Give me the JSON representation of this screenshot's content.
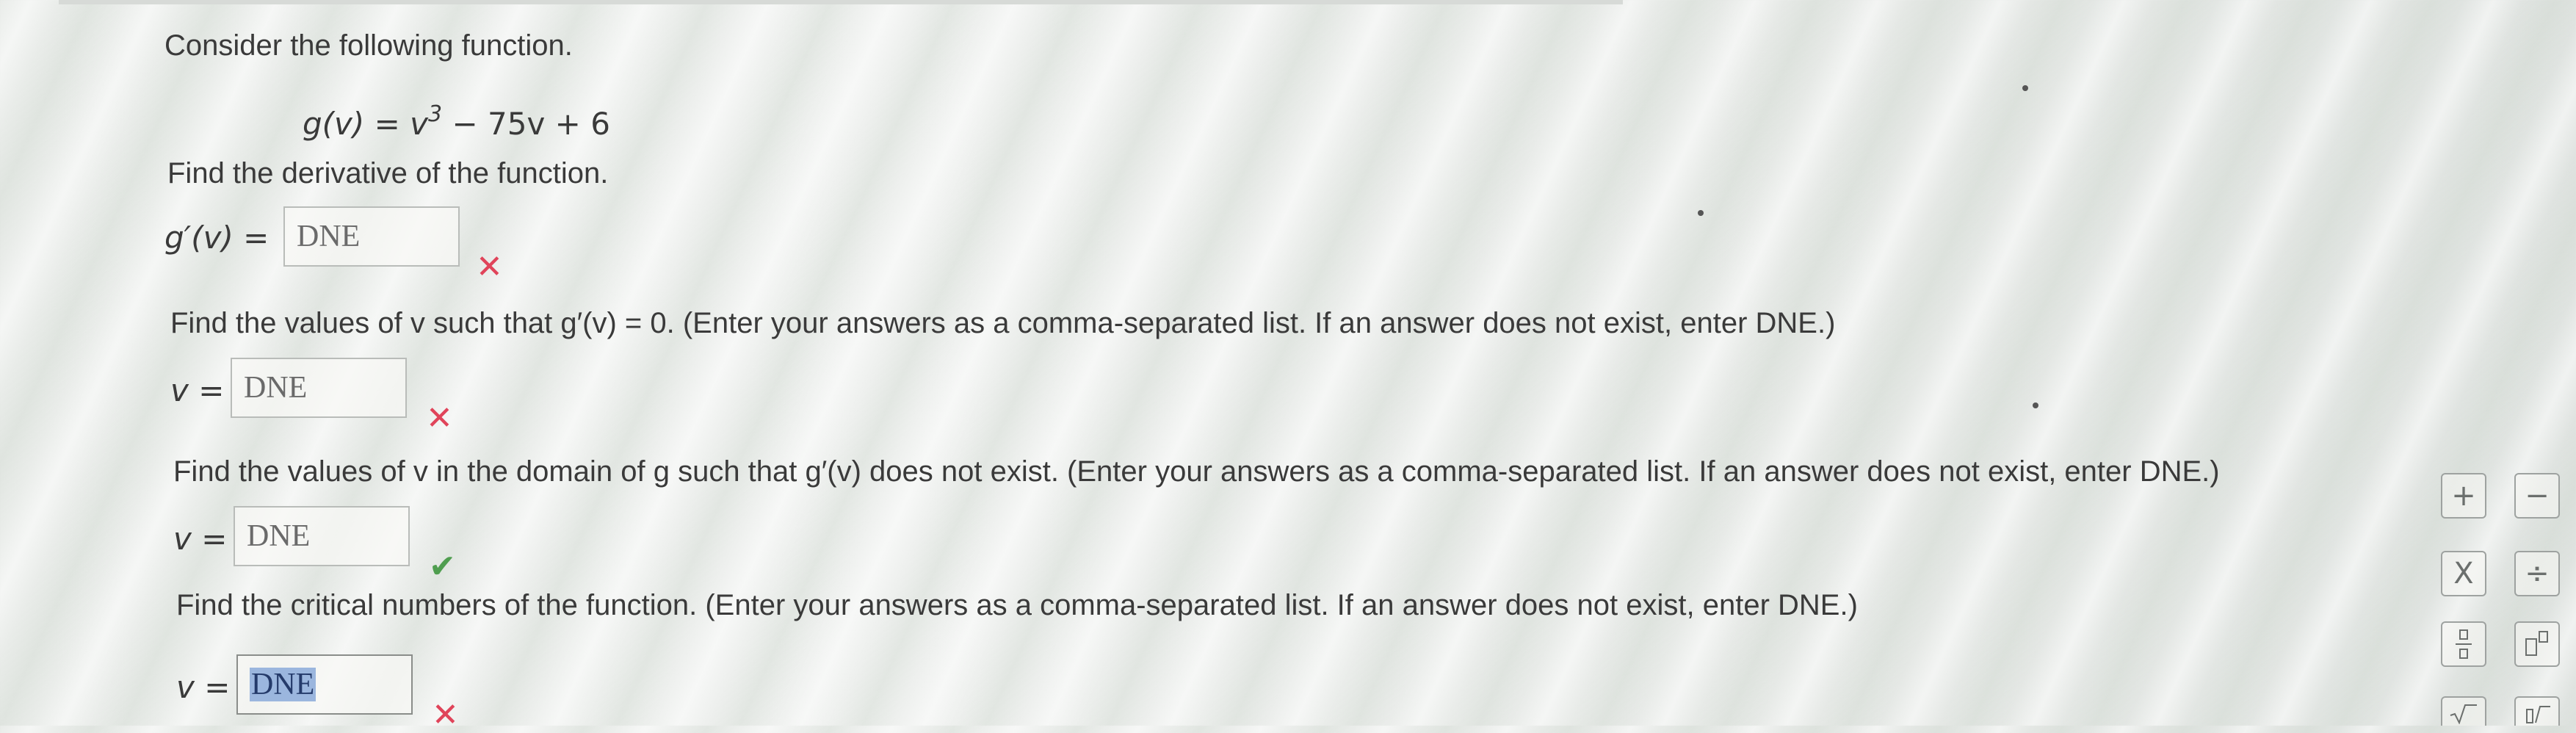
{
  "intro": "Consider the following function.",
  "function_lhs": "g(v) = v",
  "function_exp": "3",
  "function_rhs": " − 75v + 6",
  "q1": {
    "prompt": "Find the derivative of the function.",
    "label": "g′(v) = ",
    "value": "DNE",
    "status": "incorrect"
  },
  "q2": {
    "prompt": "Find the values of v such that g′(v) = 0. (Enter your answers as a comma-separated list. If an answer does not exist, enter DNE.)",
    "label": "v = ",
    "value": "DNE",
    "status": "incorrect"
  },
  "q3": {
    "prompt": "Find the values of v in the domain of g such that g′(v) does not exist. (Enter your answers as a comma-separated list. If an answer does not exist, enter DNE.)",
    "label": "v = ",
    "value": "DNE",
    "status": "correct"
  },
  "q4": {
    "prompt": "Find the critical numbers of the function. (Enter your answers as a comma-separated list. If an answer does not exist, enter DNE.)",
    "label": "v = ",
    "value": "DNE",
    "status": "incorrect"
  },
  "marks": {
    "incorrect": "✕",
    "correct": "✔"
  },
  "math_pad": {
    "plus": "+",
    "minus": "−",
    "times": "X",
    "divide": "÷"
  },
  "colors": {
    "incorrect": "#e0445a",
    "correct": "#4f9e4f",
    "selection": "#9bb6de"
  }
}
